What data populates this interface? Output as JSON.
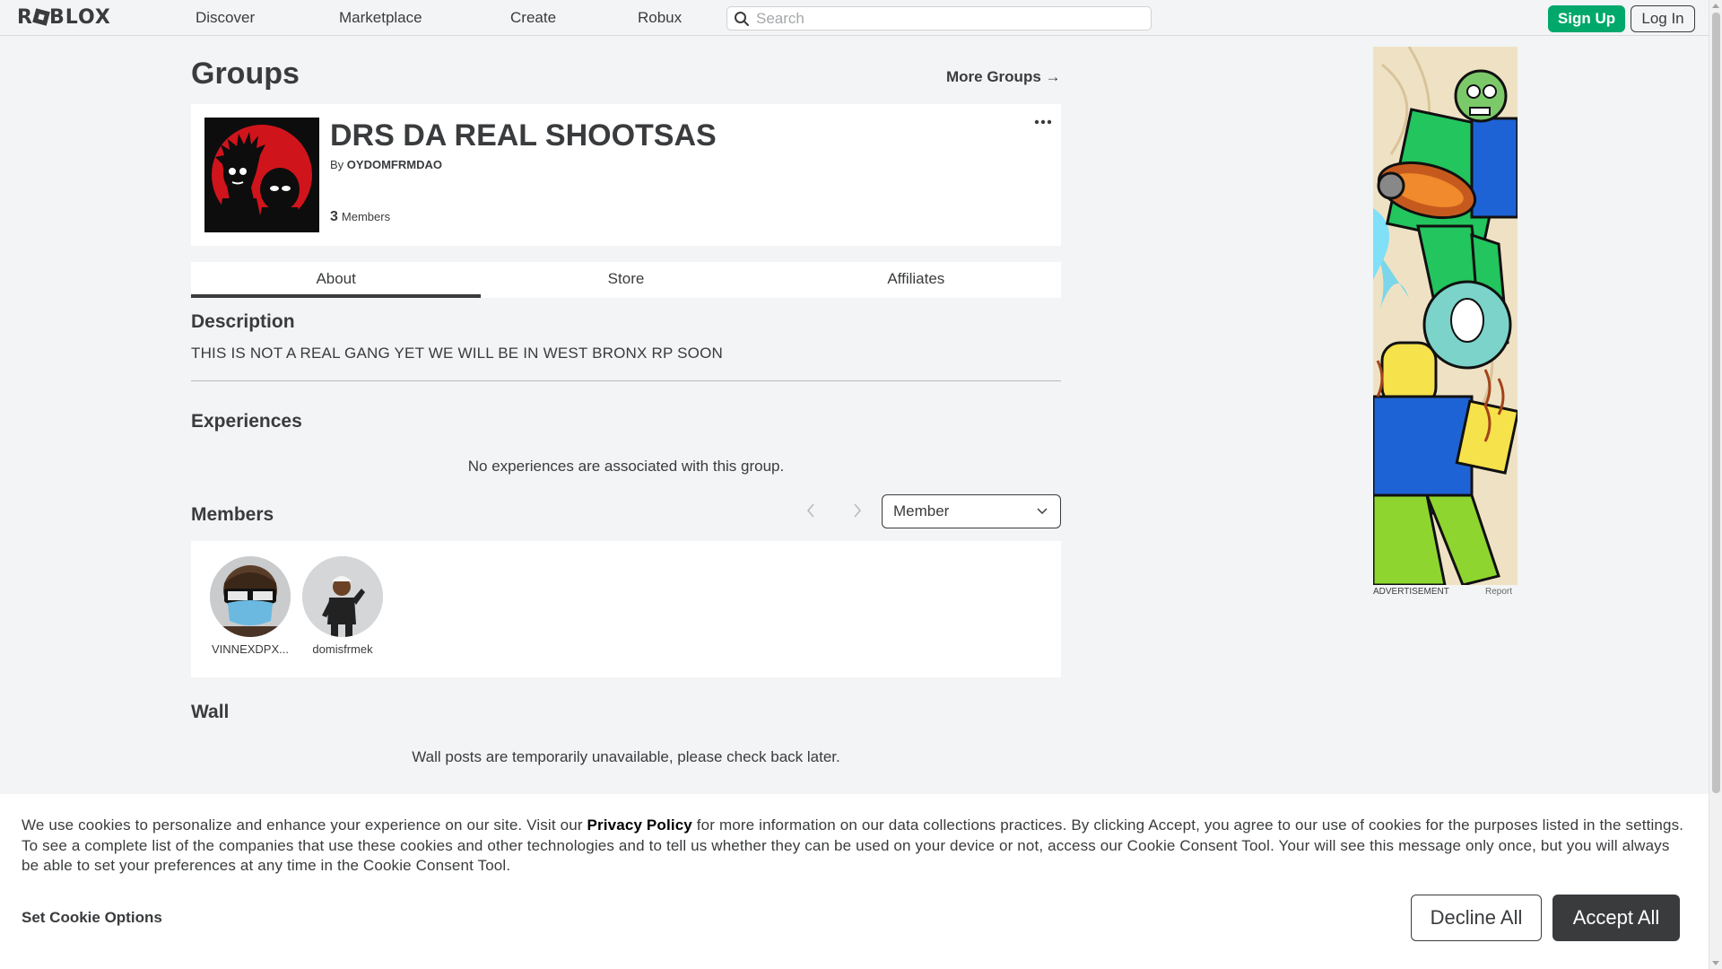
{
  "brand": {
    "logo_text_pre": "R",
    "logo_text_post": "BLOX"
  },
  "nav": {
    "links": [
      "Discover",
      "Marketplace",
      "Create",
      "Robux"
    ],
    "search_placeholder": "Search",
    "signup_label": "Sign Up",
    "login_label": "Log In"
  },
  "page": {
    "title": "Groups",
    "more_groups_label": "More Groups"
  },
  "group": {
    "name": "DRS DA REAL SHOOTSAS",
    "by_label": "By",
    "owner": "OYDOMFRMDAO",
    "member_count": "3",
    "member_count_label": "Members"
  },
  "tabs": [
    {
      "label": "About",
      "active": true
    },
    {
      "label": "Store",
      "active": false
    },
    {
      "label": "Affiliates",
      "active": false
    }
  ],
  "description": {
    "heading": "Description",
    "text": "THIS IS NOT A REAL GANG YET WE WILL BE IN WEST BRONX RP SOON"
  },
  "experiences": {
    "heading": "Experiences",
    "empty_text": "No experiences are associated with this group."
  },
  "members": {
    "heading": "Members",
    "role_selected": "Member",
    "list": [
      {
        "name": "VINNEXDPX..."
      },
      {
        "name": "domisfrmek"
      }
    ]
  },
  "wall": {
    "heading": "Wall",
    "empty_text": "Wall posts are temporarily unavailable, please check back later."
  },
  "ad": {
    "label": "ADVERTISEMENT",
    "report_label": "Report"
  },
  "cookie": {
    "text_before": "We use cookies to personalize and enhance your experience on our site. Visit our ",
    "link": "Privacy Policy",
    "text_after": " for more information on our data collections practices. By clicking Accept, you agree to our use of cookies for the purposes listed in the settings. To see a complete list of the companies that use these cookies and other technologies and to tell us whether they can be used on your device or not, access our Cookie Consent Tool. Your will see this message only once, but you will always be able to set your preferences at any time in the Cookie Consent Tool.",
    "options_label": "Set Cookie Options",
    "decline_label": "Decline All",
    "accept_label": "Accept All"
  },
  "colors": {
    "accent_green": "#00a86b",
    "text_dark": "#393b3d",
    "page_bg": "#f2f4f5"
  }
}
